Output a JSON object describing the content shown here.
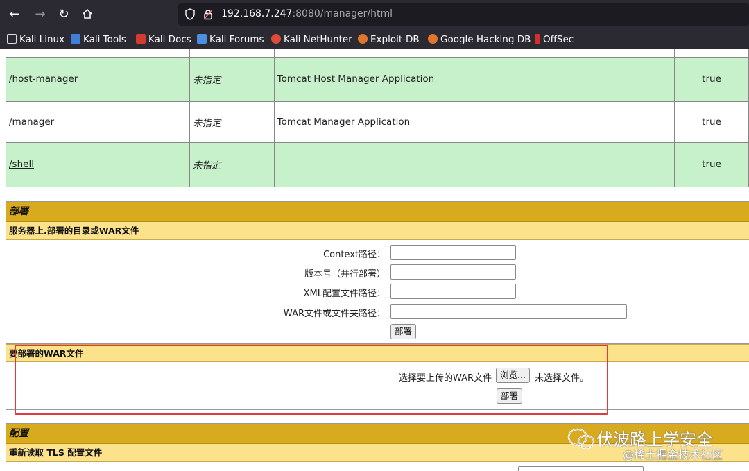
{
  "browser": {
    "url_host": "192.168.7.247",
    "url_rest": ":8080/manager/html",
    "bookmarks": [
      "Kali Linux",
      "Kali Tools",
      "Kali Docs",
      "Kali Forums",
      "Kali NetHunter",
      "Exploit-DB",
      "Google Hacking DB",
      "OffSec"
    ]
  },
  "apps": [
    {
      "path": "/host-manager",
      "version": "未指定",
      "name": "Tomcat Host Manager Application",
      "running": "true"
    },
    {
      "path": "/manager",
      "version": "未指定",
      "name": "Tomcat Manager Application",
      "running": "true"
    },
    {
      "path": "/shell",
      "version": "未指定",
      "name": "",
      "running": "true"
    }
  ],
  "deploy": {
    "title": "部署",
    "server_subtitle": "服务器上.部署的目录或WAR文件",
    "context_label": "Context路径：",
    "version_label": "版本号（并行部署）",
    "xml_label": "XML配置文件路径：",
    "war_label": "WAR文件或文件夹路径：",
    "deploy_button": "部署",
    "war_subtitle": "要部署的WAR文件",
    "choose_label": "选择要上传的WAR文件",
    "browse_button": "浏览...",
    "no_file": "未选择文件。",
    "war_deploy_button": "部署"
  },
  "config": {
    "title": "配置",
    "subtitle": "重新读取 TLS 配置文件"
  },
  "watermark": {
    "title": "伏波路上学安全",
    "subtitle": "@稀土掘金技术社区"
  }
}
